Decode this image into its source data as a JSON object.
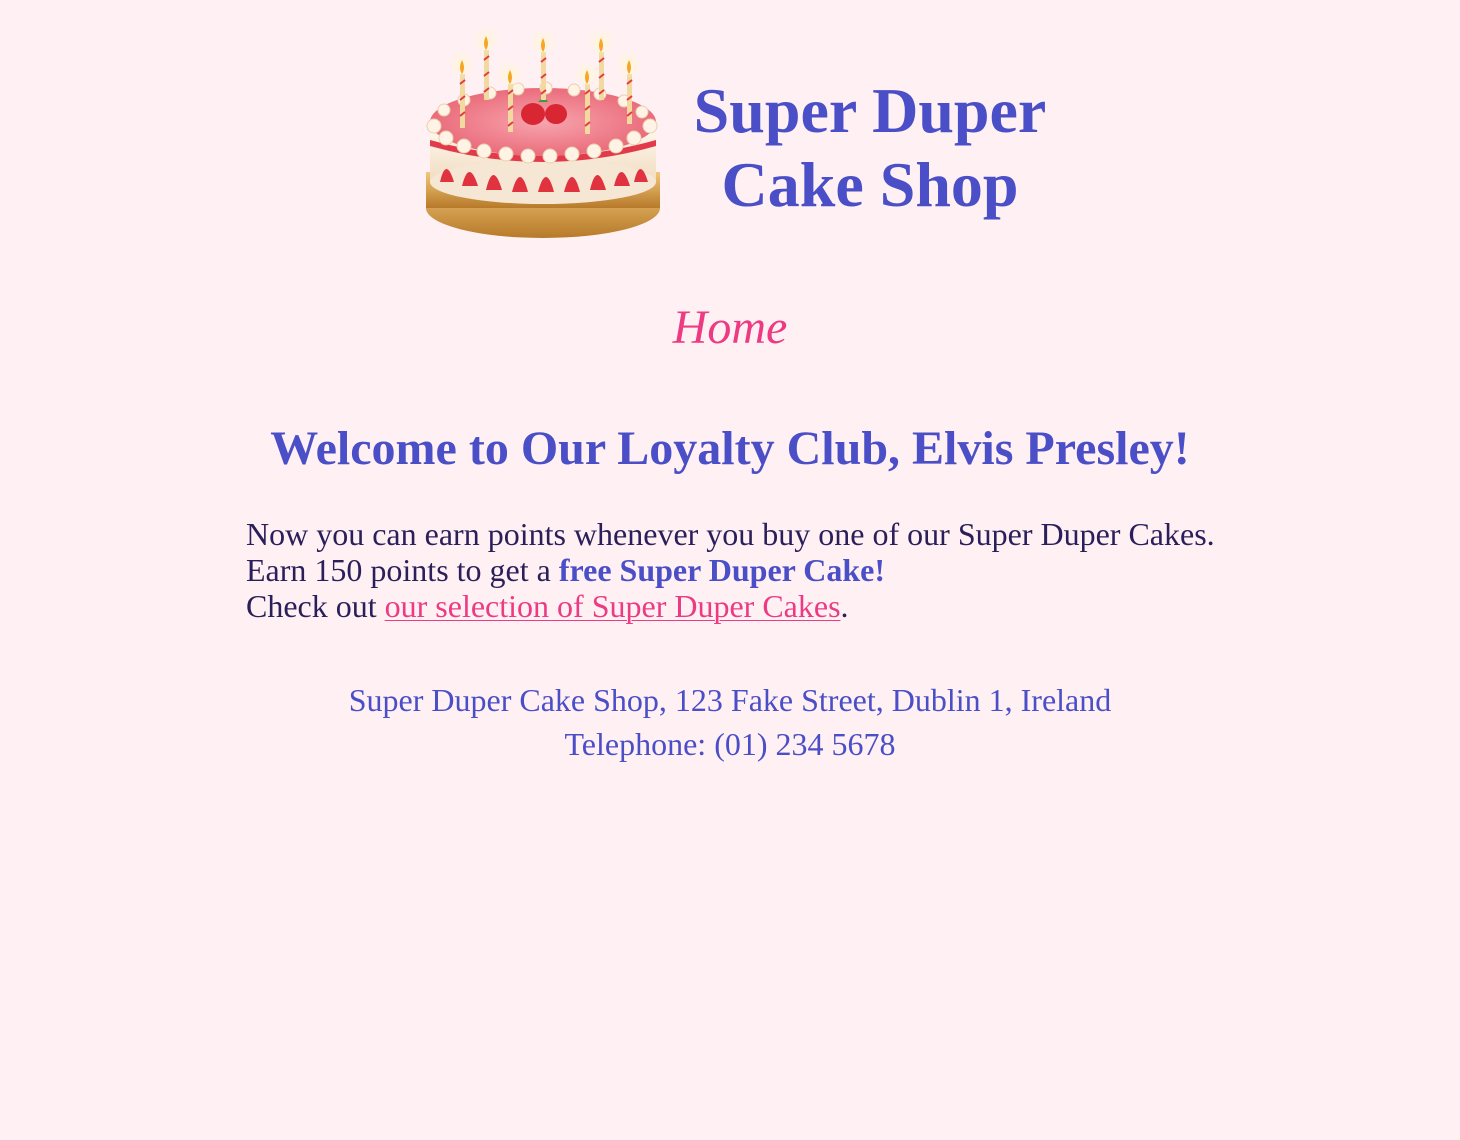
{
  "header": {
    "logo_icon": "cake-icon",
    "title_line1": "Super Duper",
    "title_line2": "Cake Shop"
  },
  "page": {
    "heading": "Home"
  },
  "welcome": {
    "title": "Welcome to Our Loyalty Club, Elvis Presley!"
  },
  "intro": {
    "line1": "Now you can earn points whenever you buy one of our Super Duper Cakes.",
    "line2_prefix": "Earn 150 points to get a ",
    "line2_emphasis": "free Super Duper Cake!",
    "line3_prefix": "Check out ",
    "line3_link": "our selection of Super Duper Cakes",
    "line3_suffix": "."
  },
  "footer": {
    "address": "Super Duper Cake Shop, 123 Fake Street, Dublin 1, Ireland",
    "telephone": "Telephone: (01) 234 5678"
  },
  "colors": {
    "background": "#fff0f3",
    "brand_blue": "#4b4fc7",
    "accent_pink": "#ec3b83",
    "body_text": "#2a1f5a"
  }
}
